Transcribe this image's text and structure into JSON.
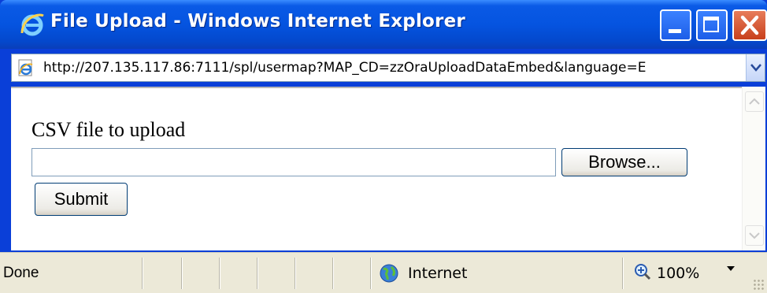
{
  "window": {
    "title": "File Upload - Windows Internet Explorer",
    "icon": "ie-icon",
    "controls": {
      "minimize": "minimize-icon",
      "maximize": "maximize-icon",
      "close": "close-icon"
    }
  },
  "address_bar": {
    "url": "http://207.135.117.86:7111/spl/usermap?MAP_CD=zzOraUploadDataEmbed&language=E",
    "icon": "page-icon"
  },
  "form": {
    "label": "CSV file to upload",
    "file_value": "",
    "browse_label": "Browse...",
    "submit_label": "Submit"
  },
  "status_bar": {
    "status": "Done",
    "zone": "Internet",
    "zoom": "100%",
    "zone_icon": "globe-icon",
    "zoom_icon": "magnifier-icon"
  },
  "colors": {
    "titlebar": "#0554e0",
    "statusbar": "#ece9d8",
    "close_button": "#c8401c"
  }
}
